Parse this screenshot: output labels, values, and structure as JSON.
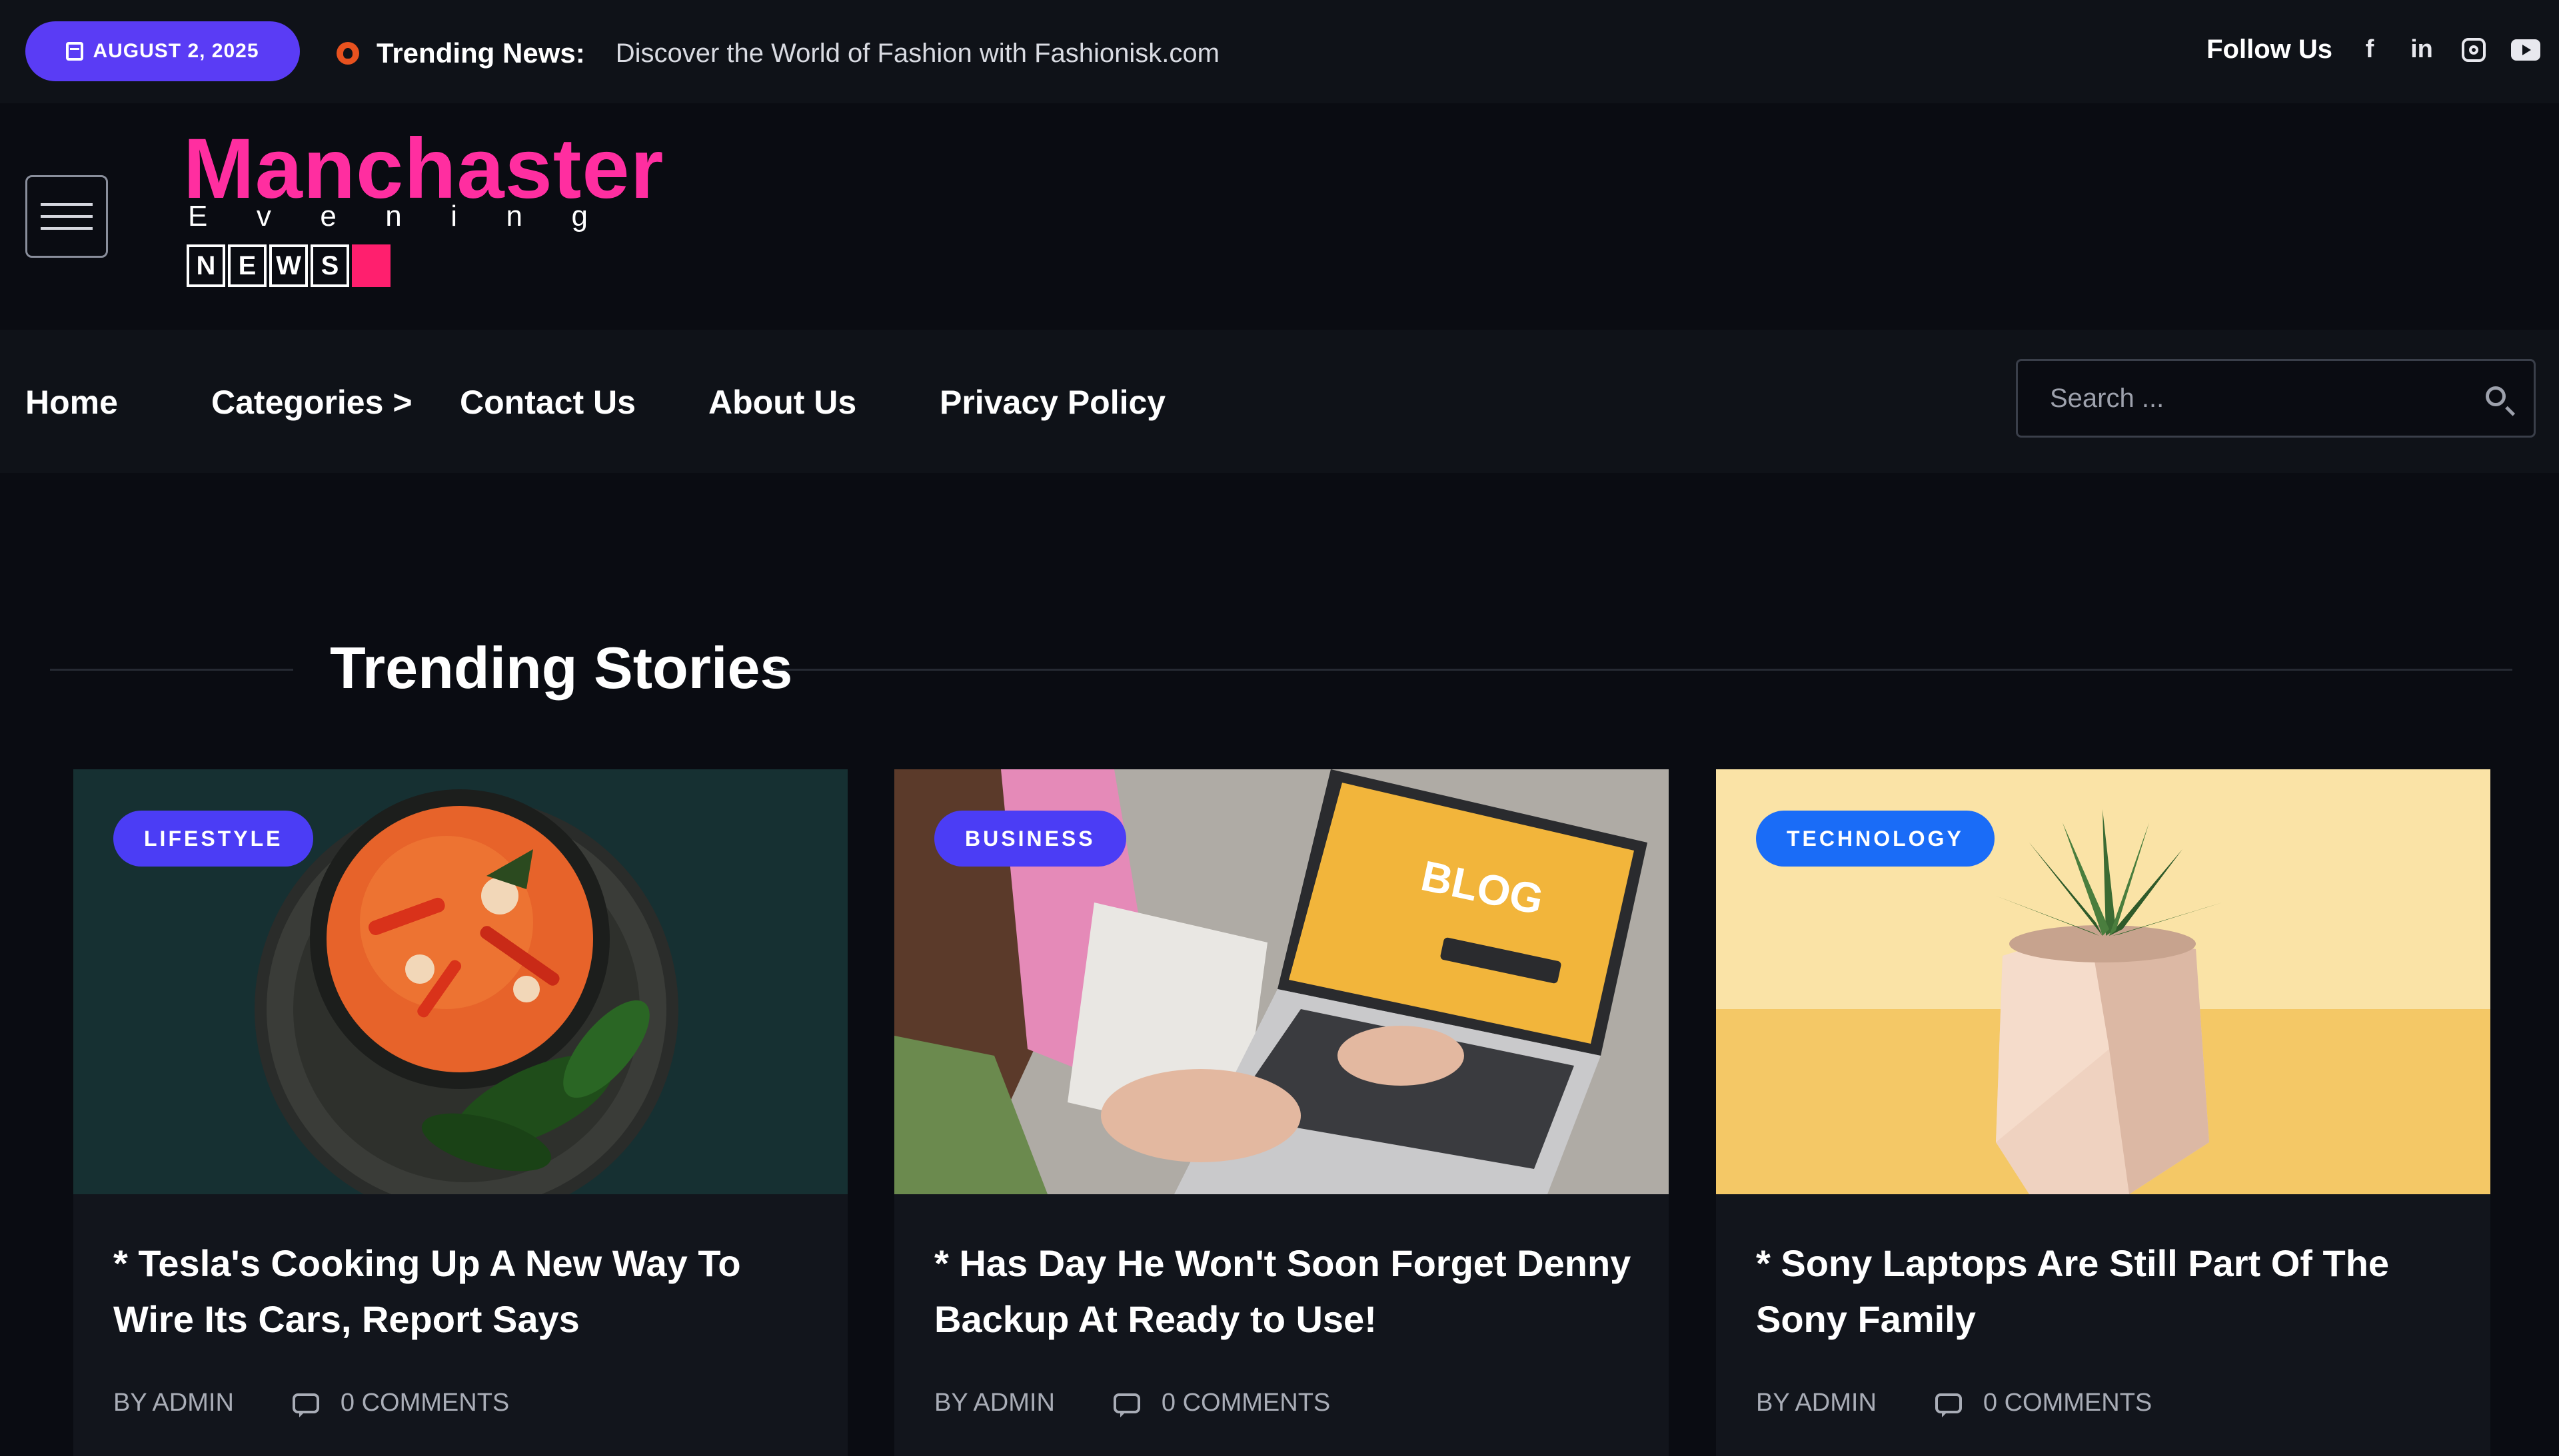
{
  "topbar": {
    "date": "AUGUST 2, 2025",
    "trending_label": "Trending News:",
    "trending_text": "Discover the World of Fashion with Fashionisk.com",
    "follow_label": "Follow Us",
    "social_icons": [
      "facebook-icon",
      "linkedin-icon",
      "instagram-icon",
      "youtube-icon"
    ]
  },
  "logo": {
    "title": "Manchaster",
    "subtitle_letters": [
      "E",
      "v",
      "e",
      "n",
      "i",
      "n",
      "g"
    ],
    "news_letters": [
      "N",
      "E",
      "W",
      "S"
    ]
  },
  "nav": {
    "items": [
      "Home",
      "Categories >",
      "Contact Us",
      "About Us",
      "Privacy Policy"
    ],
    "search_placeholder": "Search ..."
  },
  "section": {
    "title": "Trending Stories"
  },
  "cards": [
    {
      "category": "LIFESTYLE",
      "title": "* Tesla's Cooking Up A New Way To Wire Its Cars, Report Says",
      "author": "BY ADMIN",
      "comments": "0 COMMENTS"
    },
    {
      "category": "BUSINESS",
      "title": "* Has Day He Won't Soon Forget Denny Backup At Ready to Use!",
      "author": "BY ADMIN",
      "comments": "0 COMMENTS",
      "image_text": "BLOG"
    },
    {
      "category": "TECHNOLOGY",
      "title": "* Sony Laptops Are Still Part Of The Sony Family",
      "author": "BY ADMIN",
      "comments": "0 COMMENTS"
    }
  ],
  "colors": {
    "background": "#0a0c12",
    "date_pill": "#5a3cf5",
    "logo_pink": "#ff2ea0",
    "news_pink": "#ff1f6e",
    "badge_purple": "#4b3df5",
    "badge_blue": "#1a6cf7"
  }
}
